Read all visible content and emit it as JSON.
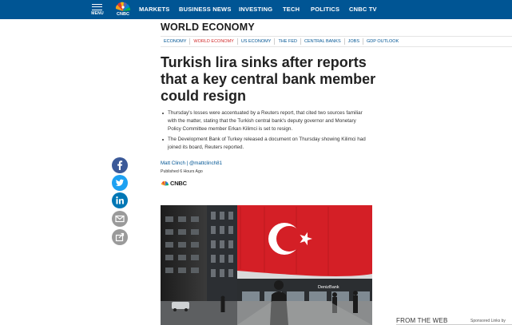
{
  "nav": {
    "menu_label": "MENU",
    "logo_text": "CNBC",
    "items": [
      "MARKETS",
      "BUSINESS NEWS",
      "INVESTING",
      "TECH",
      "POLITICS",
      "CNBC TV"
    ]
  },
  "section": {
    "title": "WORLD ECONOMY",
    "subnav": [
      "ECONOMY",
      "WORLD ECONOMY",
      "US ECONOMY",
      "THE FED",
      "CENTRAL BANKS",
      "JOBS",
      "GDP OUTLOOK"
    ],
    "active_subnav": "WORLD ECONOMY"
  },
  "article": {
    "headline": "Turkish lira sinks after reports that a key central bank member could resign",
    "bullets": [
      "Thursday's losses were accentuated by a Reuters report, that cited two sources familiar with the matter, stating that the Turkish central bank's deputy governor and Monetary Policy Committee member Erkan Kilimci is set to resign.",
      "The Development Bank of Turkey released a document on Thursday showing Kilimci had joined its board, Reuters reported."
    ],
    "byline": "Matt Clinch | @mattclinch81",
    "published": "Published 6 Hours Ago",
    "source_tag": "CNBC"
  },
  "share": [
    {
      "name": "facebook",
      "color": "#3b5998"
    },
    {
      "name": "twitter",
      "color": "#1da1f2"
    },
    {
      "name": "linkedin",
      "color": "#0077b5"
    },
    {
      "name": "email",
      "color": "#9a9a9a"
    },
    {
      "name": "print",
      "color": "#9a9a9a"
    }
  ],
  "photo": {
    "bank_sign": "DenizBank"
  },
  "sidebar": {
    "from_the_web": "FROM THE WEB",
    "sponsored": "Sponsored Links by"
  },
  "colors": {
    "nav_bg": "#005594",
    "link": "#005594",
    "active_red": "#d12b2b",
    "flag_red": "#d41f26"
  }
}
